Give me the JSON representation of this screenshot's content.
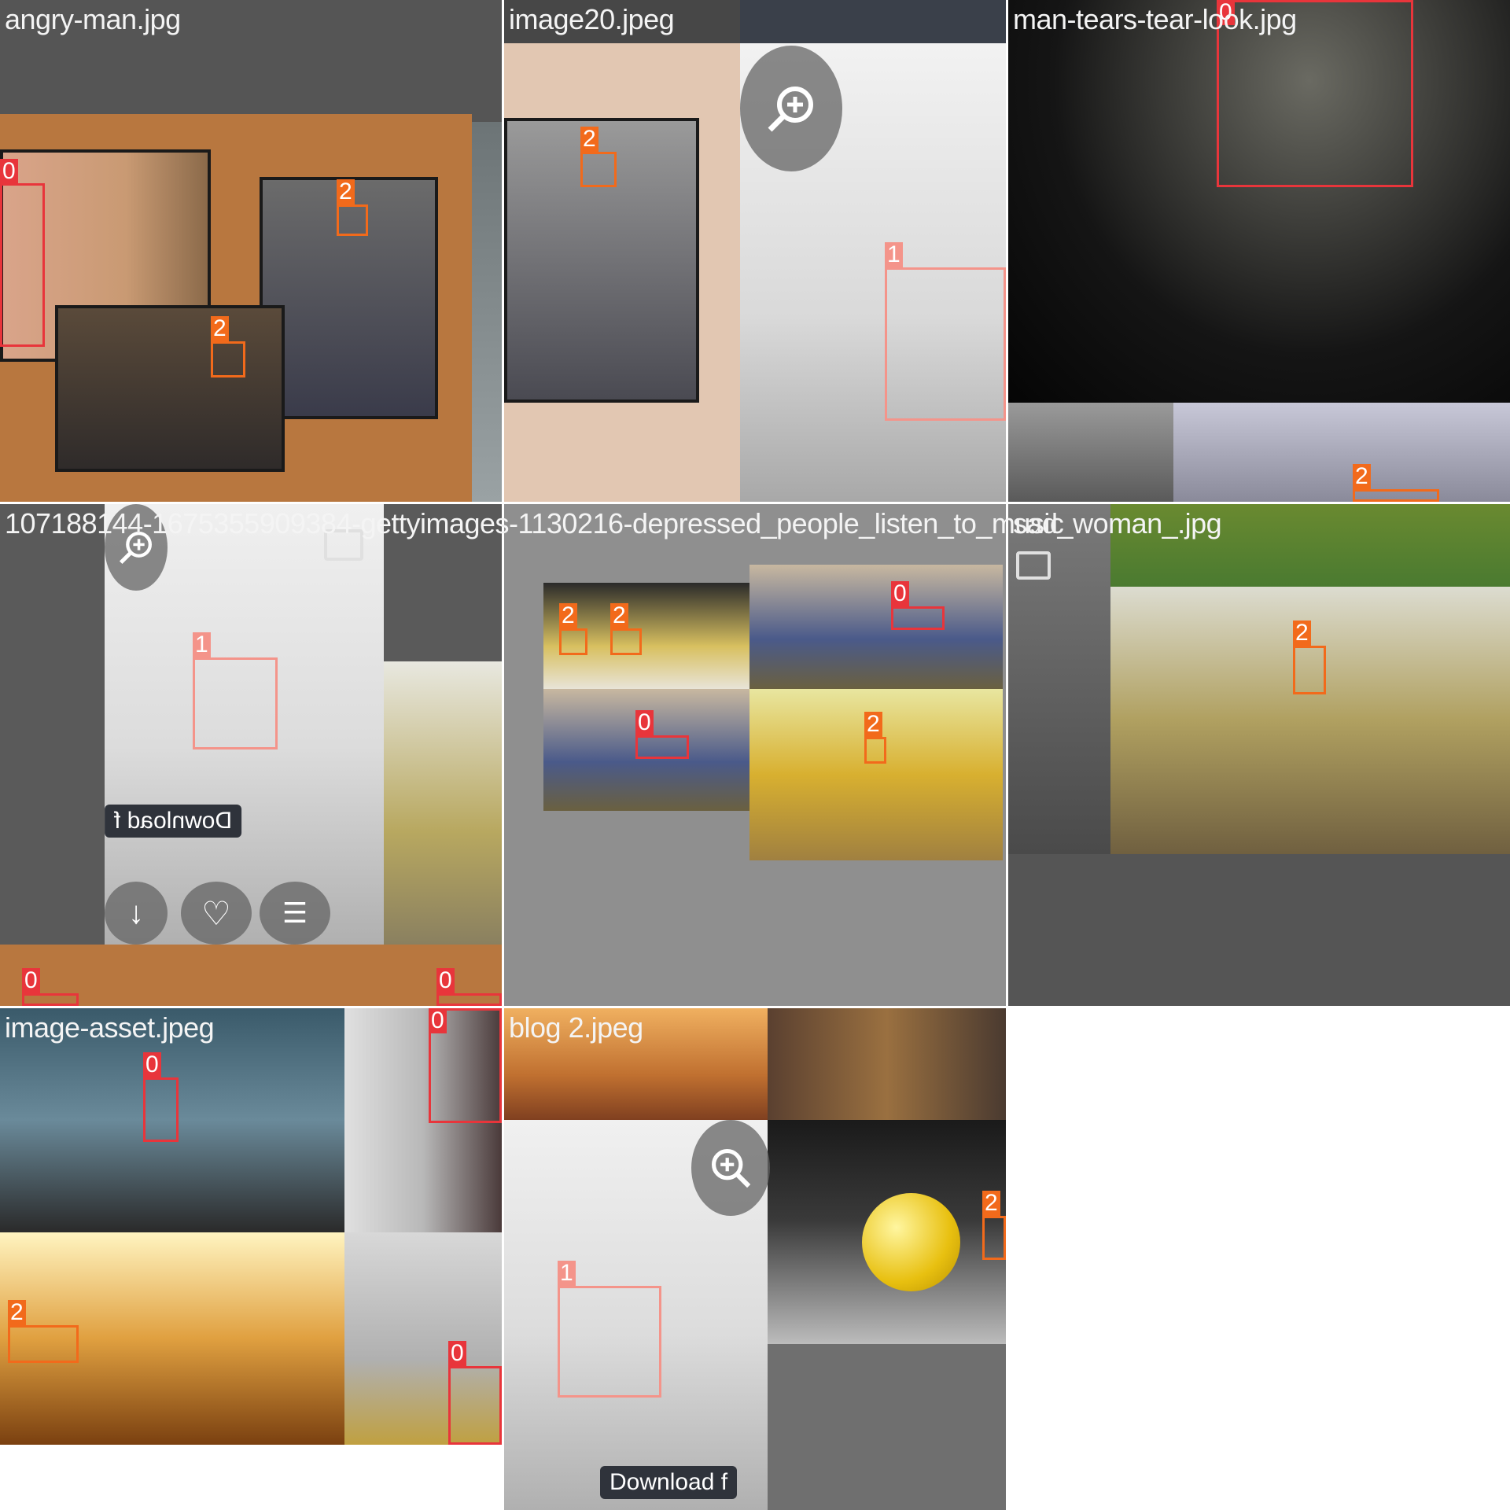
{
  "grid": {
    "tiles": [
      {
        "filename": "angry-man.jpg"
      },
      {
        "filename": "image20.jpeg"
      },
      {
        "filename": "man-tears-tear-look.jpg"
      },
      {
        "filename": "107188144-1675355909384-gettyimages-1130216-depressed_people_listen_to_music"
      },
      {
        "filename": "sad_woman_.jpg"
      },
      {
        "filename": ""
      },
      {
        "filename": "image-asset.jpeg"
      },
      {
        "filename": "blog 2.jpeg"
      }
    ]
  },
  "class_labels": {
    "c0": "0",
    "c1": "1",
    "c2": "2"
  },
  "class_colors": {
    "c0": "#e8353b",
    "c1": "#f4948a",
    "c2": "#f26a1b"
  },
  "overlays": {
    "download_tooltip_mirrored": "Download f",
    "download_tooltip": "Download f"
  },
  "icons": [
    "zoom-in-icon",
    "image-icon",
    "download-icon",
    "heart-icon",
    "stack-icon"
  ]
}
